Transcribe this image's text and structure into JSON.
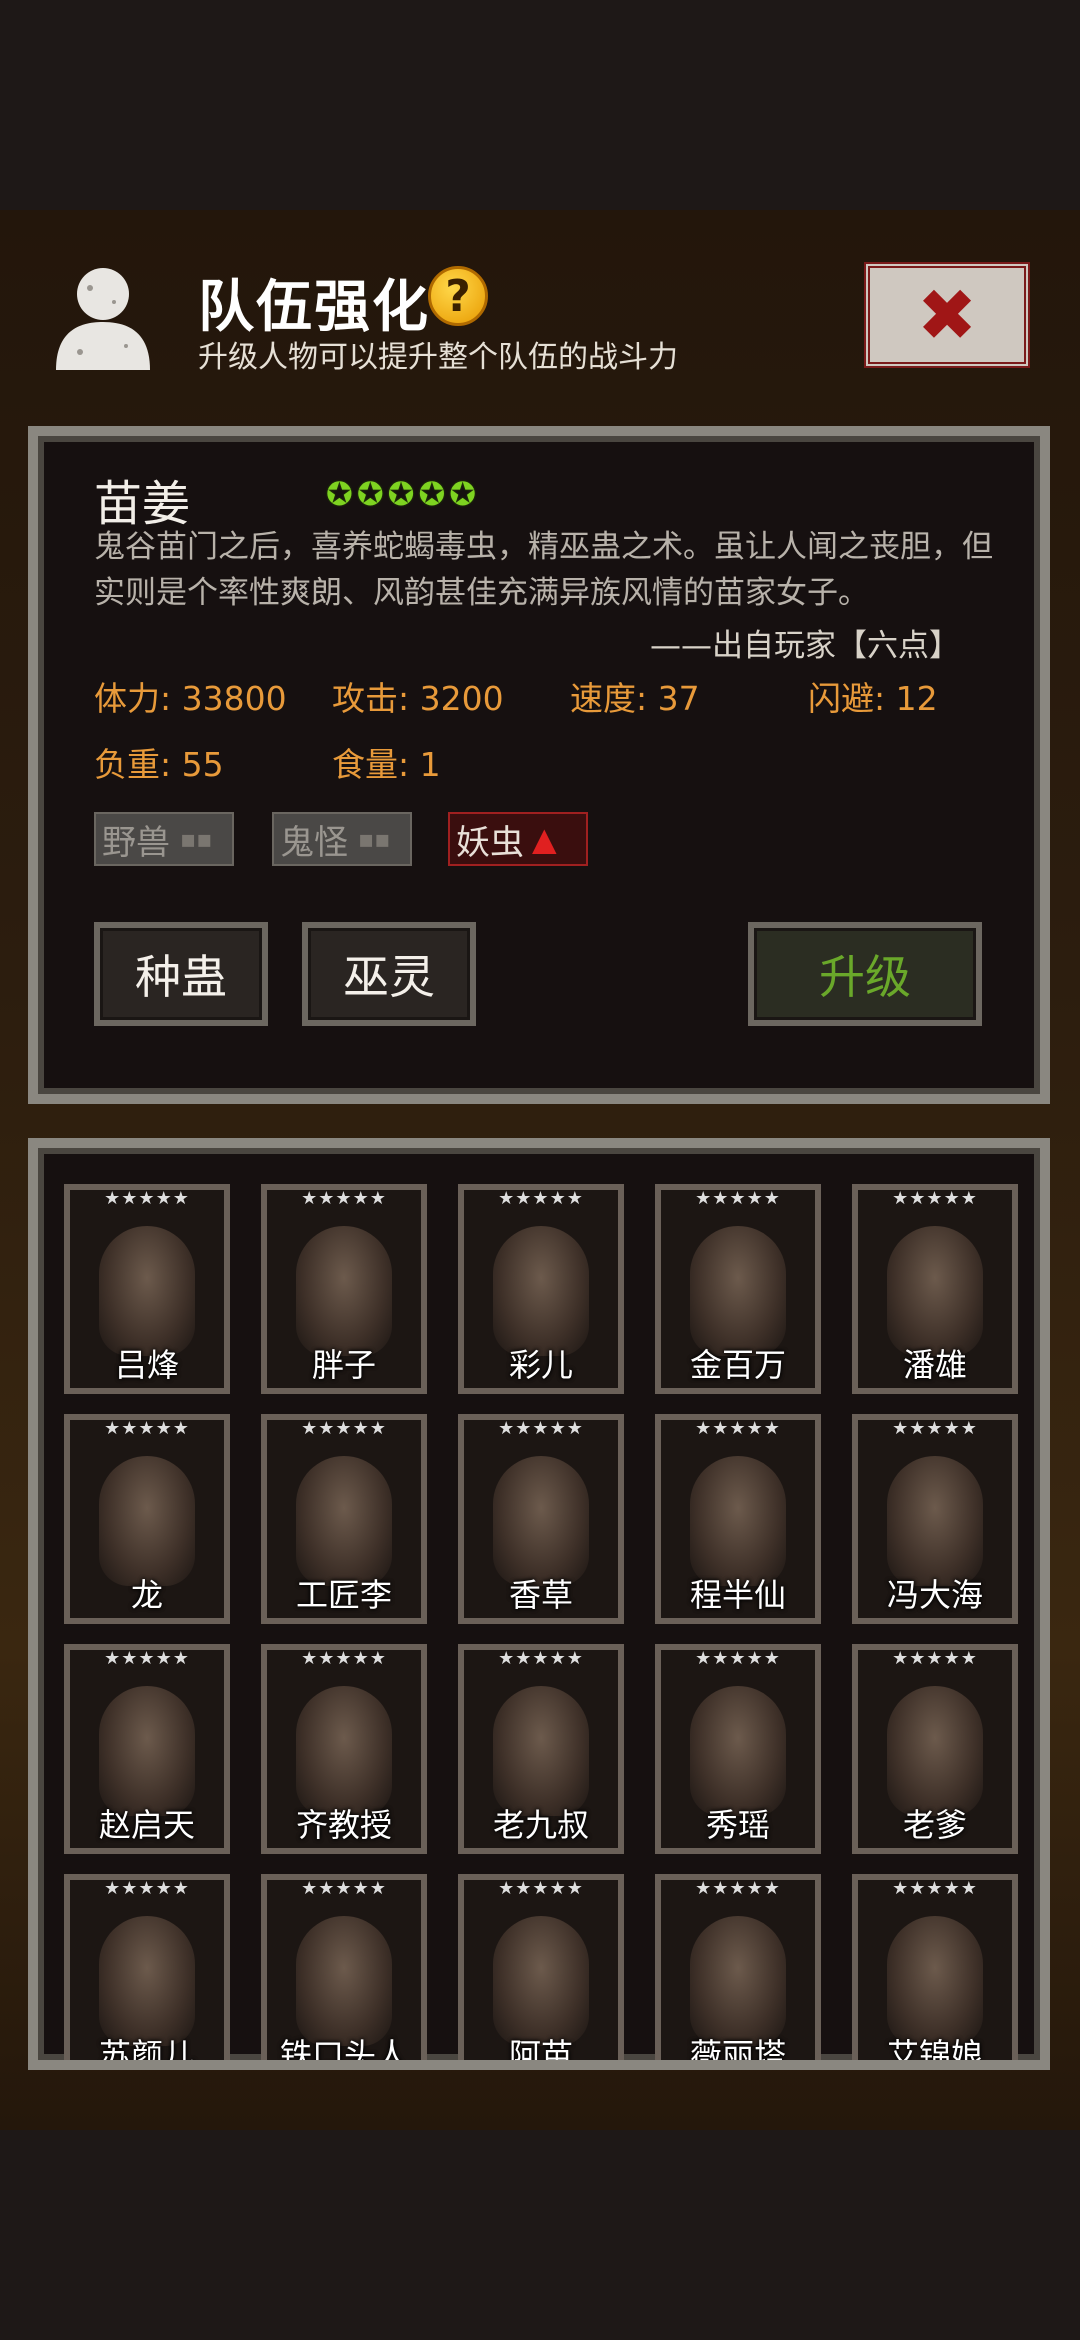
{
  "header": {
    "title": "队伍强化",
    "help_symbol": "?",
    "subtitle": "升级人物可以提升整个队伍的战斗力",
    "avatar_icon": "person-silhouette-icon",
    "close_icon": "close-x-icon"
  },
  "detail": {
    "name": "苗姜",
    "star_rating": 5,
    "description": "鬼谷苗门之后，喜养蛇蝎毒虫，精巫蛊之术。虽让人闻之丧胆，但实则是个率性爽朗、风韵甚佳充满异族风情的苗家女子。",
    "source": "——出自玩家【六点】",
    "stats": [
      {
        "text": "体力: 33800"
      },
      {
        "text": "攻击: 3200"
      },
      {
        "text": "速度: 37"
      },
      {
        "text": "闪避: 12"
      },
      {
        "text": "负重: 55"
      },
      {
        "text": "食量: 1"
      }
    ],
    "tags": [
      {
        "label": "野兽",
        "tail": "▪▪"
      },
      {
        "label": "鬼怪",
        "tail": "▪▪"
      },
      {
        "label": "妖虫",
        "tail": "▲"
      }
    ],
    "buttons": {
      "seed": "种蛊",
      "spirit": "巫灵",
      "upgrade": "升级"
    }
  },
  "characters": [
    {
      "name": "吕烽",
      "stars": "★★★★★"
    },
    {
      "name": "胖子",
      "stars": "★★★★★"
    },
    {
      "name": "彩儿",
      "stars": "★★★★★"
    },
    {
      "name": "金百万",
      "stars": "★★★★★"
    },
    {
      "name": "潘雄",
      "stars": "★★★★★"
    },
    {
      "name": "龙",
      "stars": "★★★★★"
    },
    {
      "name": "工匠李",
      "stars": "★★★★★"
    },
    {
      "name": "香草",
      "stars": "★★★★★"
    },
    {
      "name": "程半仙",
      "stars": "★★★★★"
    },
    {
      "name": "冯大海",
      "stars": "★★★★★"
    },
    {
      "name": "赵启天",
      "stars": "★★★★★"
    },
    {
      "name": "齐教授",
      "stars": "★★★★★"
    },
    {
      "name": "老九叔",
      "stars": "★★★★★"
    },
    {
      "name": "秀瑶",
      "stars": "★★★★★"
    },
    {
      "name": "老爹",
      "stars": "★★★★★"
    },
    {
      "name": "苏颜儿",
      "stars": "★★★★★"
    },
    {
      "name": "铁口头人",
      "stars": "★★★★★"
    },
    {
      "name": "阿苗",
      "stars": "★★★★★"
    },
    {
      "name": "薇丽塔",
      "stars": "★★★★★"
    },
    {
      "name": "艾锦娘",
      "stars": "★★★★★"
    }
  ],
  "colors": {
    "accent_orange": "#e89a3a",
    "star_green": "#7ed321",
    "upgrade_green": "#6aa82a",
    "close_red": "#a01616"
  }
}
